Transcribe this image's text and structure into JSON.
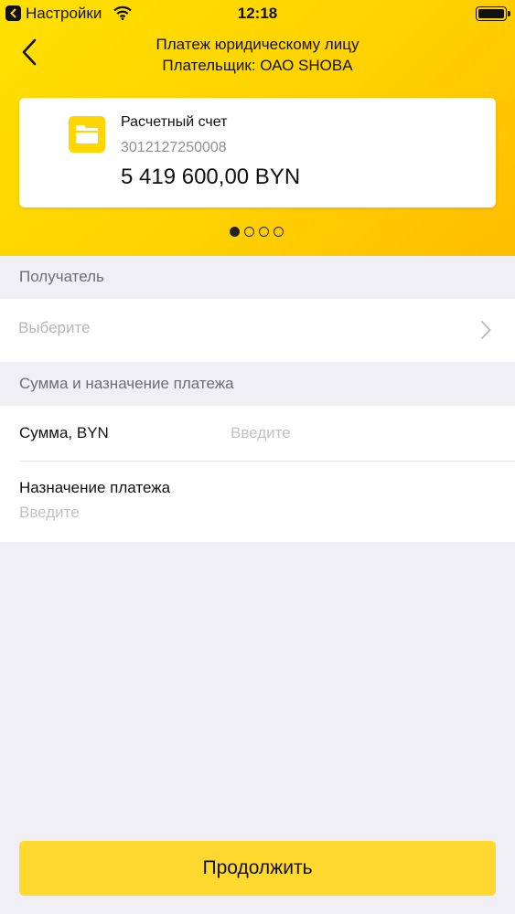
{
  "status_bar": {
    "carrier": "Настройки",
    "time": "12:18",
    "icons": [
      "back-app-icon",
      "wifi-icon",
      "battery-icon"
    ]
  },
  "nav": {
    "title_line1": "Платеж юридическому лицу",
    "title_line2": "Плательщик: ОАО SHOBA",
    "back_icon": "chevron-left-icon"
  },
  "account_card": {
    "icon": "folder-icon",
    "name": "Расчетный счет",
    "number": "3012127250008",
    "balance": "5 419 600,00 BYN"
  },
  "pager": {
    "count": 4,
    "active_index": 0
  },
  "recipient_section": {
    "header": "Получатель",
    "select_placeholder": "Выберите",
    "chevron_icon": "chevron-right-icon"
  },
  "payment_section": {
    "header": "Сумма и назначение платежа",
    "amount_label": "Сумма, BYN",
    "amount_placeholder": "Введите",
    "purpose_label": "Назначение платежа",
    "purpose_placeholder": "Введите"
  },
  "continue_button": {
    "label": "Продолжить"
  },
  "colors": {
    "accent": "#ffd600",
    "button": "#ffd930",
    "background": "#efeff4"
  }
}
